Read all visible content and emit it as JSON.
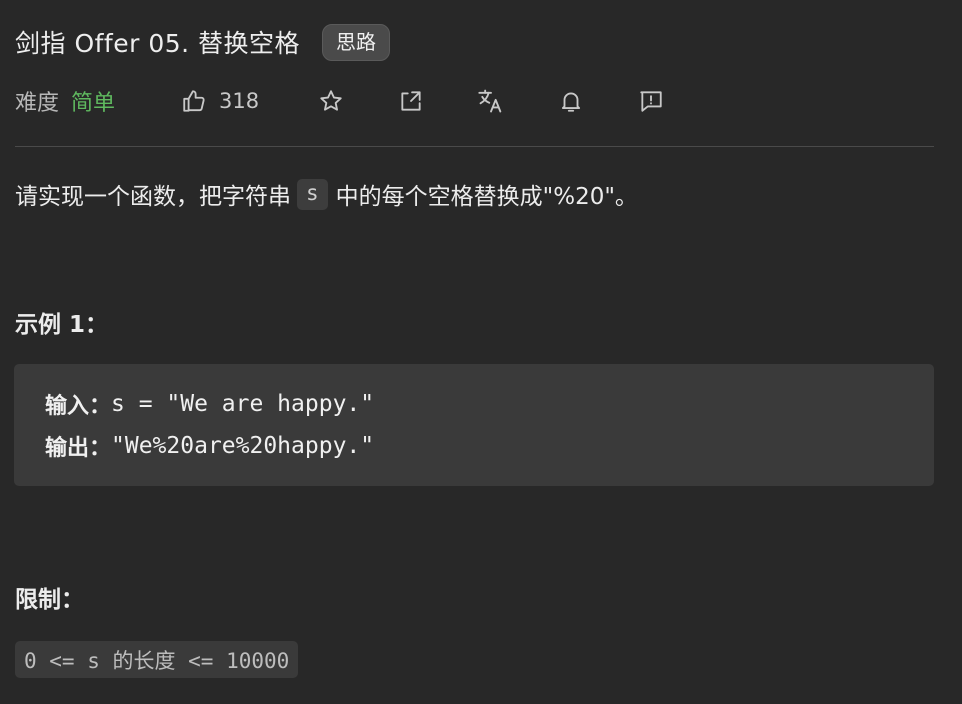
{
  "problem": {
    "title": "剑指 Offer 05. 替换空格",
    "hint_button": "思路",
    "difficulty_label": "难度",
    "difficulty": "简单",
    "likes": "318"
  },
  "toolbar_icons": [
    "thumbs-up-icon",
    "star-icon",
    "share-icon",
    "translate-icon",
    "bell-icon",
    "feedback-icon"
  ],
  "colors": {
    "background": "#282828",
    "difficulty_easy": "#5fb85f",
    "code_block": "#3a3a3a"
  },
  "description": {
    "before": "请实现一个函数，把字符串",
    "code": "s",
    "after": "中的每个空格替换成\"%20\"。"
  },
  "example": {
    "heading": "示例 1：",
    "input_label": "输入：",
    "input_value": "s = \"We are happy.\"",
    "output_label": "输出：",
    "output_value": "\"We%20are%20happy.\""
  },
  "constraints": {
    "heading": "限制：",
    "text": "0 <= s 的长度 <= 10000"
  }
}
